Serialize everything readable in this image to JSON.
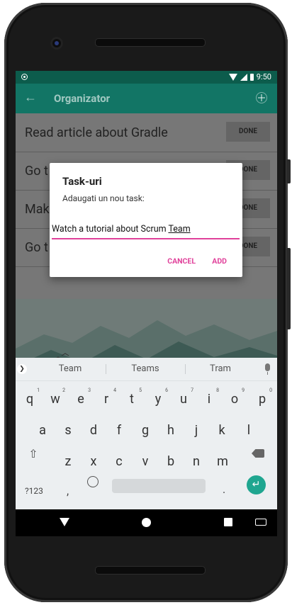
{
  "status_bar": {
    "time": "9:50"
  },
  "app_bar": {
    "title": "Organizator"
  },
  "tasks": [
    {
      "text": "Read article about Gradle",
      "button": "DONE"
    },
    {
      "text": "Go t",
      "button": "DONE"
    },
    {
      "text": "Mak",
      "button": "DONE"
    },
    {
      "text": "Go t",
      "button": "DONE"
    }
  ],
  "dialog": {
    "title": "Task-uri",
    "message": "Adaugati un nou task:",
    "input_value_prefix": "Watch a tutorial about Scrum ",
    "input_value_composing": "Team",
    "cancel_label": "CANCEL",
    "add_label": "ADD",
    "accent_color": "#e0409a"
  },
  "keyboard": {
    "suggestions": [
      "Team",
      "Teams",
      "Tram"
    ],
    "row1": [
      "q",
      "w",
      "e",
      "r",
      "t",
      "y",
      "u",
      "i",
      "o",
      "p"
    ],
    "row1_hints": [
      "1",
      "2",
      "3",
      "4",
      "5",
      "6",
      "7",
      "8",
      "9",
      "0"
    ],
    "row2": [
      "a",
      "s",
      "d",
      "f",
      "g",
      "h",
      "j",
      "k",
      "l"
    ],
    "row3": [
      "z",
      "x",
      "c",
      "v",
      "b",
      "n",
      "m"
    ],
    "symbols_label": "?123",
    "comma": ",",
    "period": ".",
    "enter_color": "#1fa690"
  },
  "colors": {
    "status_bar": "#0c5c4c",
    "app_bar": "#127565"
  }
}
